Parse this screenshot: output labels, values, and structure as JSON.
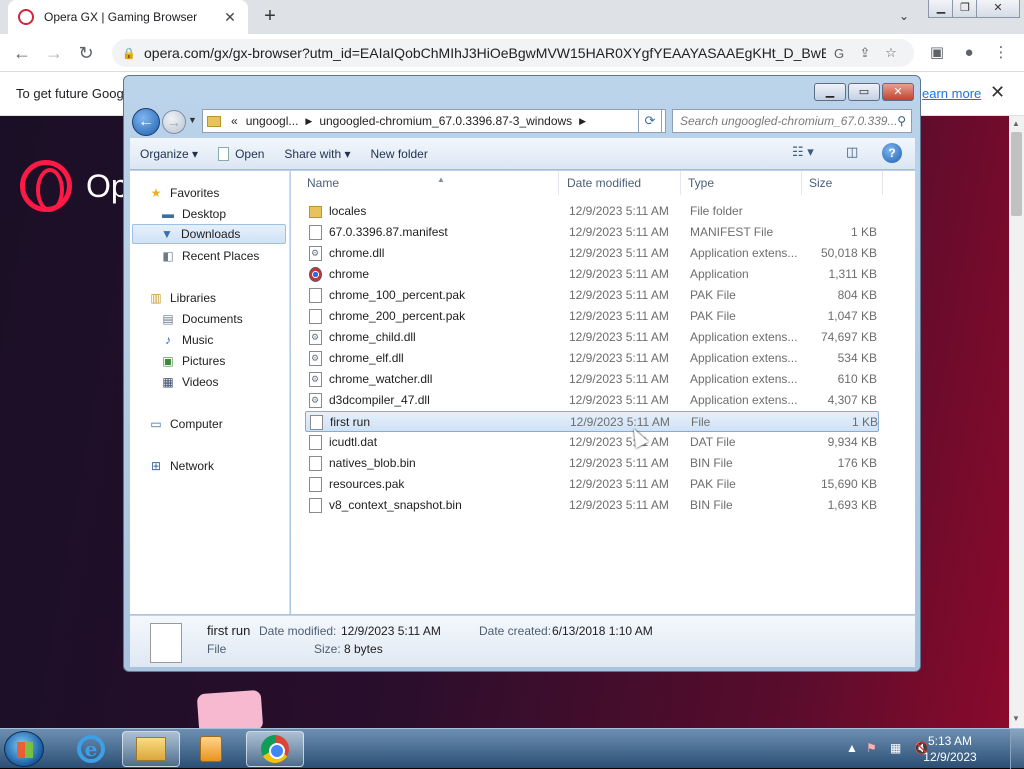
{
  "browser": {
    "tab_title": "Opera GX | Gaming Browser",
    "url": "opera.com/gx/gx-browser?utm_id=EAIaIQobChMIhJ3HiOeBgwMVW15HAR0XYgfYEAAYASAAEgKHt_D_BwE...",
    "infobar_message": "To get future Goog",
    "infobar_link": "earn more",
    "page_logo_text": "Op"
  },
  "explorer": {
    "breadcrumb": [
      "«",
      "ungoogl...",
      "ungoogled-chromium_67.0.3396.87-3_windows"
    ],
    "search_placeholder": "Search ungoogled-chromium_67.0.339...",
    "commands": {
      "organize": "Organize",
      "open": "Open",
      "share": "Share with",
      "new_folder": "New folder"
    },
    "nav": {
      "favorites": "Favorites",
      "desktop": "Desktop",
      "downloads": "Downloads",
      "recent": "Recent Places",
      "libraries": "Libraries",
      "documents": "Documents",
      "music": "Music",
      "pictures": "Pictures",
      "videos": "Videos",
      "computer": "Computer",
      "network": "Network"
    },
    "columns": {
      "name": "Name",
      "date": "Date modified",
      "type": "Type",
      "size": "Size"
    },
    "files": [
      {
        "name": "locales",
        "date": "12/9/2023 5:11 AM",
        "type": "File folder",
        "size": "",
        "icon": "folder-icon"
      },
      {
        "name": "67.0.3396.87.manifest",
        "date": "12/9/2023 5:11 AM",
        "type": "MANIFEST File",
        "size": "1 KB",
        "icon": "file-icon"
      },
      {
        "name": "chrome.dll",
        "date": "12/9/2023 5:11 AM",
        "type": "Application extens...",
        "size": "50,018 KB",
        "icon": "dll-icon"
      },
      {
        "name": "chrome",
        "date": "12/9/2023 5:11 AM",
        "type": "Application",
        "size": "1,311 KB",
        "icon": "chrome-icon"
      },
      {
        "name": "chrome_100_percent.pak",
        "date": "12/9/2023 5:11 AM",
        "type": "PAK File",
        "size": "804 KB",
        "icon": "file-icon"
      },
      {
        "name": "chrome_200_percent.pak",
        "date": "12/9/2023 5:11 AM",
        "type": "PAK File",
        "size": "1,047 KB",
        "icon": "file-icon"
      },
      {
        "name": "chrome_child.dll",
        "date": "12/9/2023 5:11 AM",
        "type": "Application extens...",
        "size": "74,697 KB",
        "icon": "dll-icon"
      },
      {
        "name": "chrome_elf.dll",
        "date": "12/9/2023 5:11 AM",
        "type": "Application extens...",
        "size": "534 KB",
        "icon": "dll-icon"
      },
      {
        "name": "chrome_watcher.dll",
        "date": "12/9/2023 5:11 AM",
        "type": "Application extens...",
        "size": "610 KB",
        "icon": "dll-icon"
      },
      {
        "name": "d3dcompiler_47.dll",
        "date": "12/9/2023 5:11 AM",
        "type": "Application extens...",
        "size": "4,307 KB",
        "icon": "dll-icon"
      },
      {
        "name": "first run",
        "date": "12/9/2023 5:11 AM",
        "type": "File",
        "size": "1 KB",
        "icon": "file-icon",
        "selected": true
      },
      {
        "name": "icudtl.dat",
        "date": "12/9/2023 5:11 AM",
        "type": "DAT File",
        "size": "9,934 KB",
        "icon": "file-icon"
      },
      {
        "name": "natives_blob.bin",
        "date": "12/9/2023 5:11 AM",
        "type": "BIN File",
        "size": "176 KB",
        "icon": "file-icon"
      },
      {
        "name": "resources.pak",
        "date": "12/9/2023 5:11 AM",
        "type": "PAK File",
        "size": "15,690 KB",
        "icon": "file-icon"
      },
      {
        "name": "v8_context_snapshot.bin",
        "date": "12/9/2023 5:11 AM",
        "type": "BIN File",
        "size": "1,693 KB",
        "icon": "file-icon"
      }
    ],
    "details": {
      "name": "first run",
      "date_modified_label": "Date modified:",
      "date_modified": "12/9/2023 5:11 AM",
      "date_created_label": "Date created:",
      "date_created": "6/13/2018 1:10 AM",
      "type": "File",
      "size_label": "Size:",
      "size": "8 bytes"
    }
  },
  "taskbar": {
    "time": "5:13 AM",
    "date": "12/9/2023"
  },
  "colors": {
    "accent": "#ff1a45",
    "selection": "#cfe2f6"
  }
}
